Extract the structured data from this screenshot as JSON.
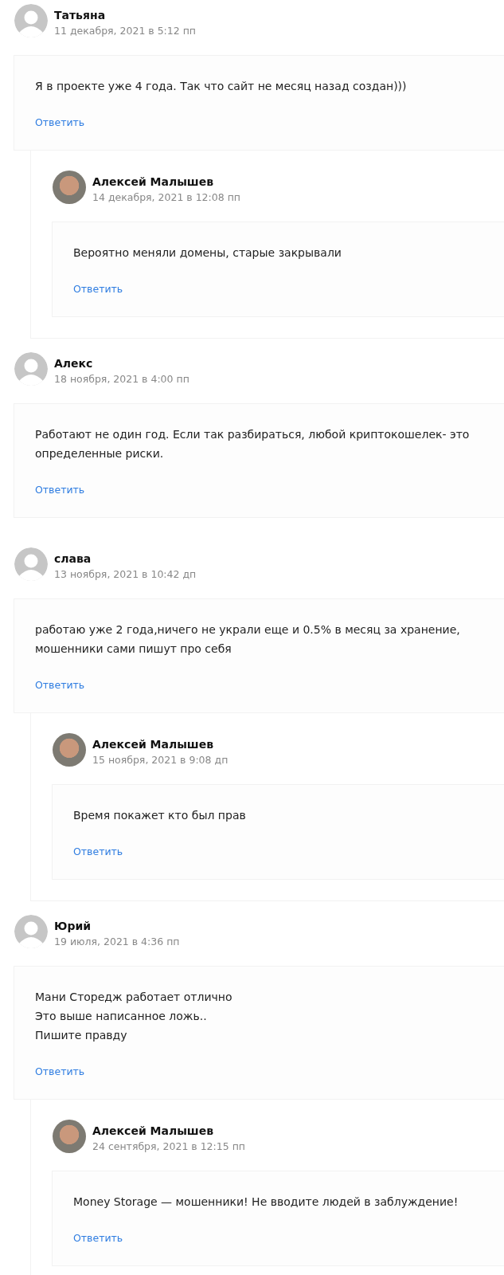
{
  "comments": [
    {
      "author": "Татьяна",
      "date": "11 декабря, 2021 в 5:12 пп",
      "avatar": {
        "kind": "default"
      },
      "text": [
        "Я в проекте уже 4 года. Так что сайт не месяц назад создан)))"
      ],
      "reply_link": "Ответить",
      "replies": [
        {
          "author": "Алексей Малышев",
          "date": "14 декабря, 2021 в 12:08 пп",
          "avatar": {
            "kind": "photo"
          },
          "text": [
            "Вероятно меняли домены, старые закрывали"
          ],
          "reply_link": "Ответить"
        }
      ]
    },
    {
      "author": "Алекс",
      "date": "18 ноября, 2021 в 4:00 пп",
      "avatar": {
        "kind": "default"
      },
      "text": [
        "Работают не один год. Если так разбираться, любой криптокошелек- это определенные риски."
      ],
      "reply_link": "Ответить"
    },
    {
      "author": "слава",
      "date": "13 ноября, 2021 в 10:42 дп",
      "avatar": {
        "kind": "default"
      },
      "text": [
        "работаю уже 2 года,ничего не украли еще и 0.5% в месяц за хранение, мошенники сами пишут про себя"
      ],
      "reply_link": "Ответить",
      "replies": [
        {
          "author": "Алексей Малышев",
          "date": "15 ноября, 2021 в 9:08 дп",
          "avatar": {
            "kind": "photo"
          },
          "text": [
            "Время покажет кто был прав"
          ],
          "reply_link": "Ответить"
        }
      ]
    },
    {
      "author": "Юрий",
      "date": "19 июля, 2021 в 4:36 пп",
      "avatar": {
        "kind": "default"
      },
      "text": [
        "Мани Сторедж работает отлично",
        "Это выше написанное ложь..",
        "Пишите правду"
      ],
      "reply_link": "Ответить",
      "replies": [
        {
          "author": "Алексей Малышев",
          "date": "24 сентября, 2021 в 12:15 пп",
          "avatar": {
            "kind": "photo"
          },
          "text": [
            "Money Storage — мошенники! Не вводите людей в заблуждение!"
          ],
          "reply_link": "Ответить"
        }
      ]
    }
  ]
}
